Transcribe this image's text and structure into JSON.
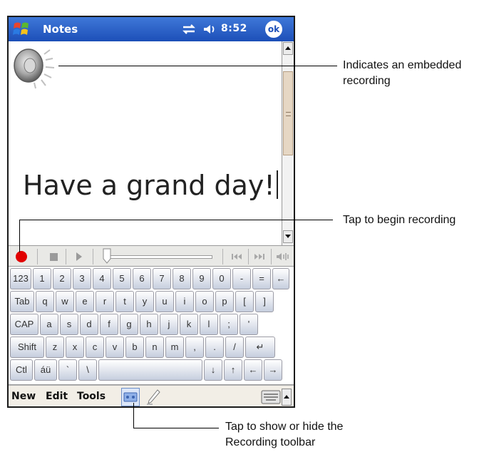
{
  "window": {
    "app_title": "Notes",
    "clock": "8:52",
    "ok_label": "ok",
    "icons": [
      "windows-start-icon",
      "connectivity-icon",
      "speaker-icon",
      "ok-button"
    ]
  },
  "note": {
    "text": "Have a grand day!",
    "embedded_icon": "speaker-recording-icon"
  },
  "recording_toolbar": {
    "buttons": [
      "record-icon",
      "stop-icon",
      "play-icon",
      "position-slider",
      "skip-back-icon",
      "skip-forward-icon",
      "volume-icon"
    ]
  },
  "keyboard": {
    "rows": [
      [
        "123",
        "1",
        "2",
        "3",
        "4",
        "5",
        "6",
        "7",
        "8",
        "9",
        "0",
        "-",
        "=",
        "←"
      ],
      [
        "Tab",
        "q",
        "w",
        "e",
        "r",
        "t",
        "y",
        "u",
        "i",
        "o",
        "p",
        "[",
        "]"
      ],
      [
        "CAP",
        "a",
        "s",
        "d",
        "f",
        "g",
        "h",
        "j",
        "k",
        "l",
        ";",
        "'"
      ],
      [
        "Shift",
        "z",
        "x",
        "c",
        "v",
        "b",
        "n",
        "m",
        ",",
        ".",
        "/",
        "↵"
      ],
      [
        "Ctl",
        "áü",
        "`",
        "\\",
        "",
        "↓",
        "↑",
        "←",
        "→"
      ]
    ]
  },
  "menubar": {
    "items": [
      "New",
      "Edit",
      "Tools"
    ]
  },
  "callouts": {
    "embedded": "Indicates an embedded recording",
    "record": "Tap to begin recording",
    "toggle": "Tap to show or hide the Recording toolbar"
  },
  "colors": {
    "title_bar": "#1c4fb8",
    "record": "#e10000",
    "key_face": "#c6cede"
  }
}
